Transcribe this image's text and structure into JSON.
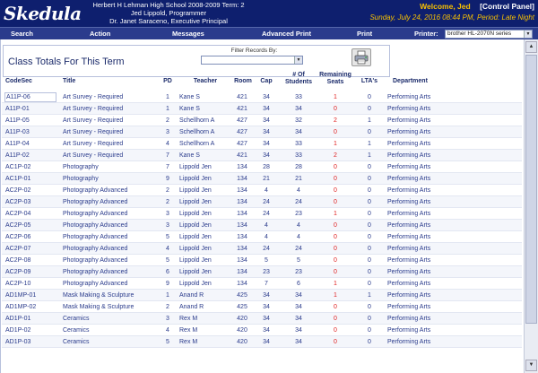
{
  "header": {
    "logo": "Skedula",
    "school_line1": "Herbert H Lehman High School 2008-2009 Term: 2",
    "school_line2": "Jed Lippold, Programmer",
    "school_line3": "Dr. Janet Saraceno, Executive Principal",
    "welcome": "Welcome, Jed",
    "control_panel": "[Control Panel]",
    "datetime": "Sunday, July 24, 2016 08:44 PM, Period: Late Night"
  },
  "menu": {
    "items": [
      "Search",
      "Action",
      "Messages",
      "Advanced Print",
      "Print"
    ],
    "printer_label": "Printer:",
    "printer_value": "brother HL-2070N series"
  },
  "page": {
    "title": "Class Totals For This Term",
    "filter_label": "Filter Records By:",
    "filter_value": "",
    "print_icon": "printer-icon"
  },
  "table": {
    "headers": {
      "codesec": "CodeSec",
      "title": "Title",
      "pd": "PD",
      "teacher": "Teacher",
      "room": "Room",
      "cap": "Cap",
      "students": "# Of Students",
      "remaining": "Remaining Seats",
      "ltas": "LTA's",
      "department": "Department"
    },
    "rows": [
      [
        "A11P-06",
        "Art Survey - Required",
        "1",
        "Kane S",
        "421",
        "34",
        "33",
        "1",
        "0",
        "Performing Arts"
      ],
      [
        "A11P-01",
        "Art Survey - Required",
        "1",
        "Kane S",
        "421",
        "34",
        "34",
        "0",
        "0",
        "Performing Arts"
      ],
      [
        "A11P-05",
        "Art Survey - Required",
        "2",
        "Schellhorn A",
        "427",
        "34",
        "32",
        "2",
        "1",
        "Performing Arts"
      ],
      [
        "A11P-03",
        "Art Survey - Required",
        "3",
        "Schellhorn A",
        "427",
        "34",
        "34",
        "0",
        "0",
        "Performing Arts"
      ],
      [
        "A11P-04",
        "Art Survey - Required",
        "4",
        "Schellhorn A",
        "427",
        "34",
        "33",
        "1",
        "1",
        "Performing Arts"
      ],
      [
        "A11P-02",
        "Art Survey - Required",
        "7",
        "Kane S",
        "421",
        "34",
        "33",
        "2",
        "1",
        "Performing Arts"
      ],
      [
        "AC1P-02",
        "Photography",
        "7",
        "Lippold Jen",
        "134",
        "28",
        "28",
        "0",
        "0",
        "Performing Arts"
      ],
      [
        "AC1P-01",
        "Photography",
        "9",
        "Lippold Jen",
        "134",
        "21",
        "21",
        "0",
        "0",
        "Performing Arts"
      ],
      [
        "AC2P-02",
        "Photography Advanced",
        "2",
        "Lippold Jen",
        "134",
        "4",
        "4",
        "0",
        "0",
        "Performing Arts"
      ],
      [
        "AC2P-03",
        "Photography Advanced",
        "2",
        "Lippold Jen",
        "134",
        "24",
        "24",
        "0",
        "0",
        "Performing Arts"
      ],
      [
        "AC2P-04",
        "Photography Advanced",
        "3",
        "Lippold Jen",
        "134",
        "24",
        "23",
        "1",
        "0",
        "Performing Arts"
      ],
      [
        "AC2P-05",
        "Photography Advanced",
        "3",
        "Lippold Jen",
        "134",
        "4",
        "4",
        "0",
        "0",
        "Performing Arts"
      ],
      [
        "AC2P-06",
        "Photography Advanced",
        "5",
        "Lippold Jen",
        "134",
        "4",
        "4",
        "0",
        "0",
        "Performing Arts"
      ],
      [
        "AC2P-07",
        "Photography Advanced",
        "4",
        "Lippold Jen",
        "134",
        "24",
        "24",
        "0",
        "0",
        "Performing Arts"
      ],
      [
        "AC2P-08",
        "Photography Advanced",
        "5",
        "Lippold Jen",
        "134",
        "5",
        "5",
        "0",
        "0",
        "Performing Arts"
      ],
      [
        "AC2P-09",
        "Photography Advanced",
        "6",
        "Lippold Jen",
        "134",
        "23",
        "23",
        "0",
        "0",
        "Performing Arts"
      ],
      [
        "AC2P-10",
        "Photography Advanced",
        "9",
        "Lippold Jen",
        "134",
        "7",
        "6",
        "1",
        "0",
        "Performing Arts"
      ],
      [
        "AD1MP-01",
        "Mask Making & Sculpture",
        "1",
        "Anand R",
        "425",
        "34",
        "34",
        "1",
        "1",
        "Performing Arts"
      ],
      [
        "AD1MP-02",
        "Mask Making & Sculpture",
        "2",
        "Anand R",
        "425",
        "34",
        "34",
        "0",
        "0",
        "Performing Arts"
      ],
      [
        "AD1P-01",
        "Ceramics",
        "3",
        "Rex M",
        "420",
        "34",
        "34",
        "0",
        "0",
        "Performing Arts"
      ],
      [
        "AD1P-02",
        "Ceramics",
        "4",
        "Rex M",
        "420",
        "34",
        "34",
        "0",
        "0",
        "Performing Arts"
      ],
      [
        "AD1P-03",
        "Ceramics",
        "5",
        "Rex M",
        "420",
        "34",
        "34",
        "0",
        "0",
        "Performing Arts"
      ]
    ]
  }
}
